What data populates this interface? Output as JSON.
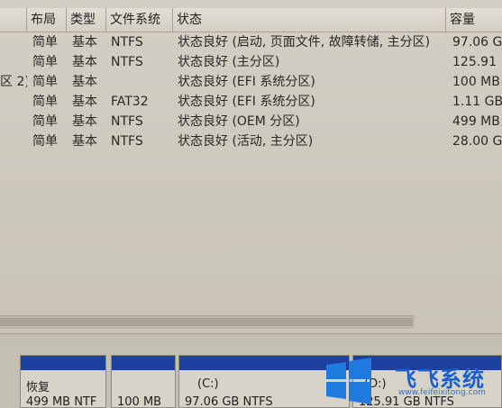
{
  "columns": {
    "layout": "布局",
    "type": "类型",
    "filesystem": "文件系统",
    "status": "状态",
    "capacity": "容量"
  },
  "volumes": [
    {
      "name": "",
      "layout": "简单",
      "type": "基本",
      "filesystem": "NTFS",
      "status": "状态良好 (启动, 页面文件, 故障转储, 主分区)",
      "capacity": "97.06 G"
    },
    {
      "name": "",
      "layout": "简单",
      "type": "基本",
      "filesystem": "NTFS",
      "status": "状态良好 (主分区)",
      "capacity": "125.91"
    },
    {
      "name": "区 2)",
      "layout": "简单",
      "type": "基本",
      "filesystem": "",
      "status": "状态良好 (EFI 系统分区)",
      "capacity": "100 MB"
    },
    {
      "name": "",
      "layout": "简单",
      "type": "基本",
      "filesystem": "FAT32",
      "status": "状态良好 (EFI 系统分区)",
      "capacity": "1.11 GB"
    },
    {
      "name": "",
      "layout": "简单",
      "type": "基本",
      "filesystem": "NTFS",
      "status": "状态良好 (OEM 分区)",
      "capacity": "499 MB"
    },
    {
      "name": "",
      "layout": "简单",
      "type": "基本",
      "filesystem": "NTFS",
      "status": "状态良好 (活动, 主分区)",
      "capacity": "28.00 G"
    }
  ],
  "disk_partitions": [
    {
      "label": "恢复",
      "size": "499 MB NTF"
    },
    {
      "label": "",
      "size": "100 MB"
    },
    {
      "label": "(C:)",
      "size": "97.06 GB NTFS"
    },
    {
      "label": "(D:)",
      "size": "125.91 GB NTFS"
    }
  ],
  "watermark": {
    "title": "飞飞系统",
    "url": "www.feifeixitong.com"
  },
  "colors": {
    "partition_bar": "#1d3f9e",
    "watermark_blue": "#1a5fd0"
  }
}
